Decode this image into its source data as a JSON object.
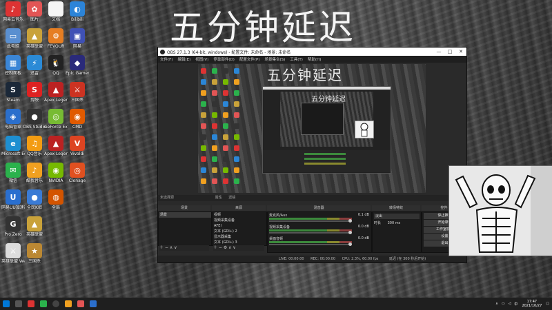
{
  "overlay_title": "五分钟延迟",
  "desktop_icons": [
    {
      "label": "网易云音乐",
      "color": "#d33",
      "glyph": "♪",
      "col": 0,
      "row": 0
    },
    {
      "label": "此电脑",
      "color": "#5a8fd0",
      "glyph": "▭",
      "col": 0,
      "row": 1
    },
    {
      "label": "控制面板",
      "color": "#3b86d6",
      "glyph": "▦",
      "col": 0,
      "row": 2
    },
    {
      "label": "Steam",
      "color": "#1b2838",
      "glyph": "S",
      "col": 0,
      "row": 3
    },
    {
      "label": "电脑管家",
      "color": "#2b6fcc",
      "glyph": "◈",
      "col": 0,
      "row": 4
    },
    {
      "label": "Microsoft Edge",
      "color": "#1e8fd1",
      "glyph": "e",
      "col": 0,
      "row": 5
    },
    {
      "label": "微信",
      "color": "#2bb24c",
      "glyph": "✉",
      "col": 0,
      "row": 6
    },
    {
      "label": "网易UU加速器",
      "color": "#2a6fcf",
      "glyph": "U",
      "col": 0,
      "row": 7
    },
    {
      "label": "Pro Zero",
      "color": "#333",
      "glyph": "G",
      "col": 0,
      "row": 8
    },
    {
      "label": "英雄联盟 WeGame版",
      "color": "#ddd",
      "glyph": "⚔",
      "col": 0,
      "row": 9
    },
    {
      "label": "图片",
      "color": "#e25555",
      "glyph": "✿",
      "col": 1,
      "row": 0
    },
    {
      "label": "英雄联盟",
      "color": "#c9a23a",
      "glyph": "▲",
      "col": 1,
      "row": 1
    },
    {
      "label": "迅雷",
      "color": "#2b8ad6",
      "glyph": "⚡",
      "col": 1,
      "row": 2
    },
    {
      "label": "剪映",
      "color": "#d22",
      "glyph": "S",
      "col": 1,
      "row": 3
    },
    {
      "label": "OBS Studio",
      "color": "#333",
      "glyph": "●",
      "col": 1,
      "row": 4
    },
    {
      "label": "QQ音乐",
      "color": "#f39c12",
      "glyph": "♫",
      "col": 1,
      "row": 5
    },
    {
      "label": "酷我音乐",
      "color": "#f0a020",
      "glyph": "♪",
      "col": 1,
      "row": 6
    },
    {
      "label": "全民K歌",
      "color": "#3a7bd5",
      "glyph": "●",
      "col": 1,
      "row": 7
    },
    {
      "label": "英雄联盟",
      "color": "#c9a23a",
      "glyph": "▲",
      "col": 1,
      "row": 8
    },
    {
      "label": "三国杀",
      "color": "#b83",
      "glyph": "★",
      "col": 1,
      "row": 9
    },
    {
      "label": "文档",
      "color": "#f5f5f5",
      "glyph": "",
      "col": 2,
      "row": 0
    },
    {
      "label": "FEVOUR",
      "color": "#e67e22",
      "glyph": "⚙",
      "col": 2,
      "row": 1
    },
    {
      "label": "QQ",
      "color": "#222",
      "glyph": "🐧",
      "col": 2,
      "row": 2
    },
    {
      "label": "Apex Legends",
      "color": "#b22",
      "glyph": "▲",
      "col": 2,
      "row": 3
    },
    {
      "label": "GeForce Experience",
      "color": "#7b3",
      "glyph": "◎",
      "col": 2,
      "row": 4
    },
    {
      "label": "Apex Legends",
      "color": "#b22",
      "glyph": "▲",
      "col": 2,
      "row": 5
    },
    {
      "label": "NVIDIA",
      "color": "#76b900",
      "glyph": "◉",
      "col": 2,
      "row": 6
    },
    {
      "label": "全局",
      "color": "#d35400",
      "glyph": "◍",
      "col": 2,
      "row": 7
    },
    {
      "label": "Bilibili",
      "color": "#2c84d8",
      "glyph": "◐",
      "col": 3,
      "row": 0
    },
    {
      "label": "网易",
      "color": "#3f51b5",
      "glyph": "▣",
      "col": 3,
      "row": 1
    },
    {
      "label": "Epic Games",
      "color": "#2a2a7a",
      "glyph": "◆",
      "col": 3,
      "row": 2
    },
    {
      "label": "三国杀",
      "color": "#cc3322",
      "glyph": "⚔",
      "col": 3,
      "row": 3
    },
    {
      "label": "CMD",
      "color": "#e05a00",
      "glyph": "◉",
      "col": 3,
      "row": 4
    },
    {
      "label": "Vivaldi",
      "color": "#dd4422",
      "glyph": "V",
      "col": 3,
      "row": 5
    },
    {
      "label": "Clonage",
      "color": "#e05020",
      "glyph": "◎",
      "col": 3,
      "row": 6
    }
  ],
  "obs": {
    "title": "OBS 27.1.3 (64-bit, windows) - 配置文件: 未命名 - 场景: 未命名",
    "menu": [
      "文件(F)",
      "编辑(E)",
      "视图(V)",
      "停靠部件(D)",
      "配置文件(P)",
      "场景集合(S)",
      "工具(T)",
      "帮助(H)"
    ],
    "preview_title": "五分钟延迟",
    "inner_title": "五分钟延迟",
    "source_bar": "未选择源",
    "toolbar_props": "属性",
    "toolbar_filters": "滤镜",
    "docks": {
      "scenes_header": "场景",
      "sources_header": "来源",
      "mixer_header": "混音器",
      "transitions_header": "转场特效",
      "controls_header": "控件"
    },
    "scenes": [
      "场景"
    ],
    "sources": [
      "视频",
      "视频采集设备",
      "AFEI",
      "文本 (GDI+) 2",
      "显示器采集",
      "文本 (GDI+) 3"
    ],
    "mixer": [
      {
        "name": "麦克风/Aux",
        "db": "0.1 dB"
      },
      {
        "name": "视频采集设备",
        "db": "0.0 dB"
      },
      {
        "name": "桌面音频",
        "db": "0.0 dB"
      }
    ],
    "transition": "淡出",
    "duration_label": "时长",
    "duration_value": "300 ms",
    "controls": [
      "停止推流",
      "开始录制",
      "工作室模式",
      "设置",
      "退出"
    ],
    "status": {
      "live": "LIVE: 00:00:00",
      "rec": "REC: 00:00:00",
      "cpu": "CPU: 2.3%, 60.00 fps",
      "delay": "延迟 (在 300 秒后开始)"
    }
  },
  "taskbar": {
    "clock_time": "17:47",
    "clock_date": "2021/10/27",
    "lang": "中"
  }
}
